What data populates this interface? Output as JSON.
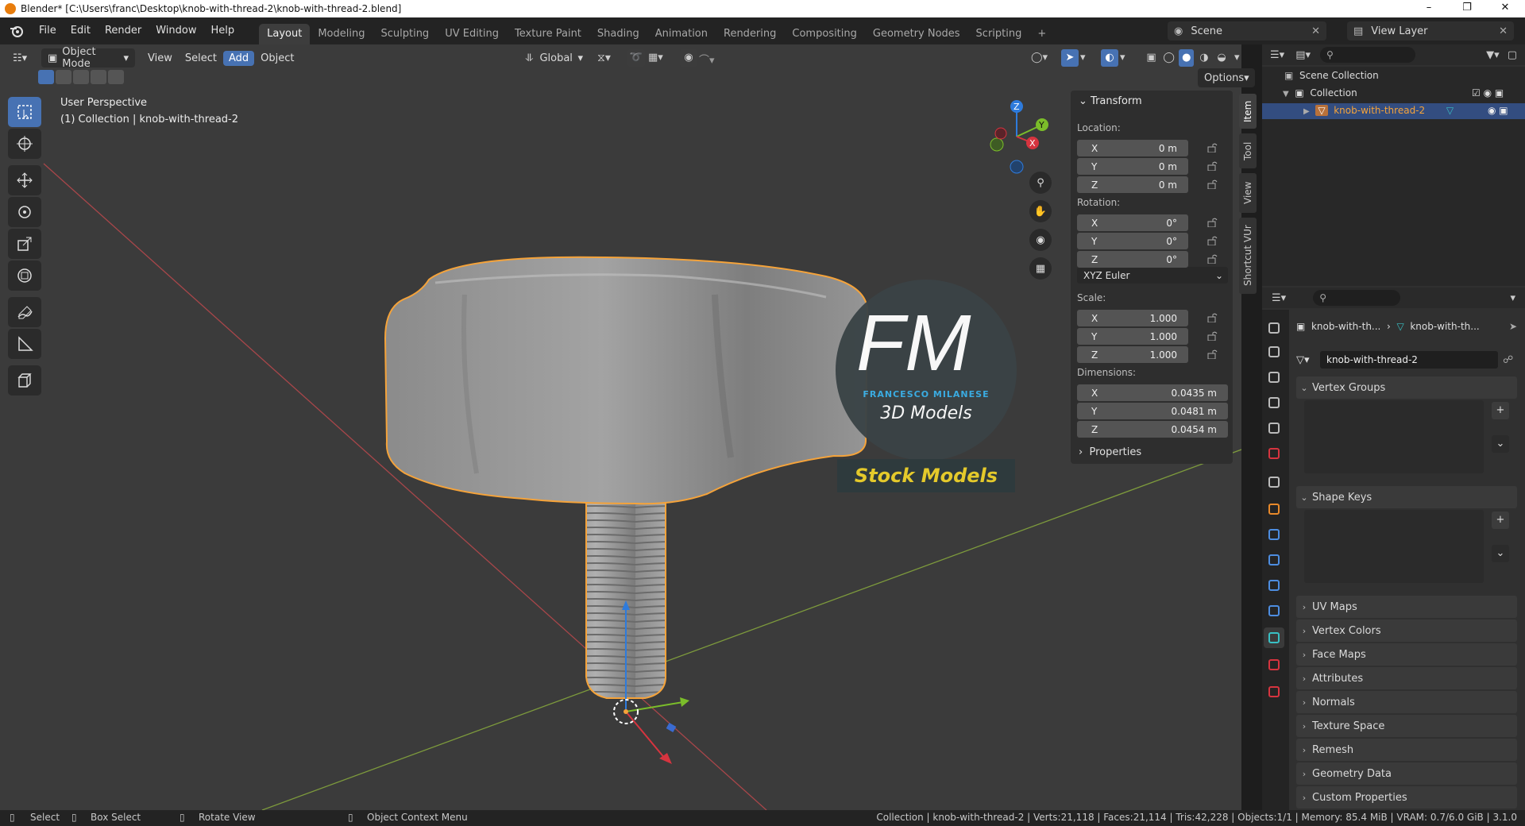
{
  "window": {
    "title": "Blender* [C:\\Users\\franc\\Desktop\\knob-with-thread-2\\knob-with-thread-2.blend]",
    "min": "–",
    "max": "❐",
    "close": "✕"
  },
  "menu": [
    "File",
    "Edit",
    "Render",
    "Window",
    "Help"
  ],
  "workspaces": [
    "Layout",
    "Modeling",
    "Sculpting",
    "UV Editing",
    "Texture Paint",
    "Shading",
    "Animation",
    "Rendering",
    "Compositing",
    "Geometry Nodes",
    "Scripting",
    "+"
  ],
  "scene": {
    "label": "Scene",
    "view_layer": "View Layer"
  },
  "viewport_header": {
    "mode": "Object Mode",
    "menus": [
      "View",
      "Select",
      "Add",
      "Object"
    ],
    "orientation": "Global",
    "options": "Options"
  },
  "overlay_text": {
    "perspective": "User Perspective",
    "collection": "(1) Collection | knob-with-thread-2"
  },
  "sidebar_tabs": [
    "Item",
    "Tool",
    "View",
    "Shortcut VUr"
  ],
  "transform": {
    "title": "Transform",
    "location_label": "Location:",
    "rotation_label": "Rotation:",
    "scale_label": "Scale:",
    "dimensions_label": "Dimensions:",
    "location": [
      {
        "axis": "X",
        "value": "0 m"
      },
      {
        "axis": "Y",
        "value": "0 m"
      },
      {
        "axis": "Z",
        "value": "0 m"
      }
    ],
    "rotation": [
      {
        "axis": "X",
        "value": "0°"
      },
      {
        "axis": "Y",
        "value": "0°"
      },
      {
        "axis": "Z",
        "value": "0°"
      }
    ],
    "rotation_mode": "XYZ Euler",
    "scale": [
      {
        "axis": "X",
        "value": "1.000"
      },
      {
        "axis": "Y",
        "value": "1.000"
      },
      {
        "axis": "Z",
        "value": "1.000"
      }
    ],
    "dimensions": [
      {
        "axis": "X",
        "value": "0.0435 m"
      },
      {
        "axis": "Y",
        "value": "0.0481 m"
      },
      {
        "axis": "Z",
        "value": "0.0454 m"
      }
    ],
    "properties": "Properties"
  },
  "watermark": {
    "letters": "FM",
    "name": "FRANCESCO MILANESE",
    "sub": "3D Models",
    "banner": "Stock Models"
  },
  "outliner": {
    "scene_collection": "Scene Collection",
    "collection": "Collection",
    "object": "knob-with-thread-2"
  },
  "properties": {
    "breadcrumb": [
      "knob-with-th...",
      "knob-with-th..."
    ],
    "mesh_name": "knob-with-thread-2",
    "sections": [
      "Vertex Groups",
      "Shape Keys",
      "UV Maps",
      "Vertex Colors",
      "Face Maps",
      "Attributes",
      "Normals",
      "Texture Space",
      "Remesh",
      "Geometry Data",
      "Custom Properties"
    ]
  },
  "gizmo": {
    "x": "X",
    "y": "Y",
    "z": "Z"
  },
  "statusbar": {
    "select": "Select",
    "box_select": "Box Select",
    "rotate": "Rotate View",
    "context": "Object Context Menu",
    "stats": "Collection | knob-with-thread-2 | Verts:21,118 | Faces:21,114 | Tris:42,228 | Objects:1/1 | Memory: 85.4 MiB | VRAM: 0.7/6.0 GiB | 3.1.0"
  },
  "colors": {
    "accent": "#4772b3",
    "selection": "#f5a33a",
    "header": "#232323"
  }
}
